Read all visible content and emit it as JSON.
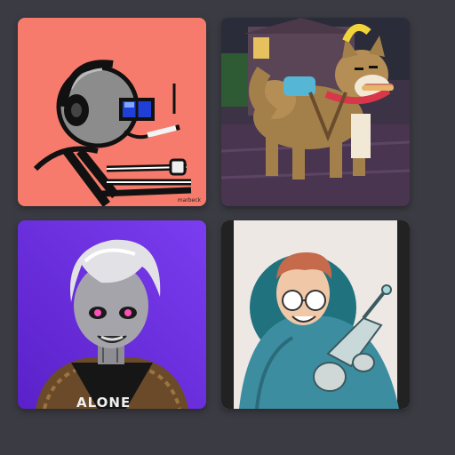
{
  "gallery": {
    "tiles": [
      {
        "name": "stick-figure-gamer-avatar",
        "bg": "#f77b6c",
        "signature": "marbeck"
      },
      {
        "name": "shiba-dog-avatar",
        "bg": "#3d3346"
      },
      {
        "name": "silver-haired-android-avatar",
        "bg": "#6b2de0",
        "shirt_text": "ALONE"
      },
      {
        "name": "scientist-ray-gun-avatar",
        "bg": "#eee8e4"
      }
    ]
  }
}
